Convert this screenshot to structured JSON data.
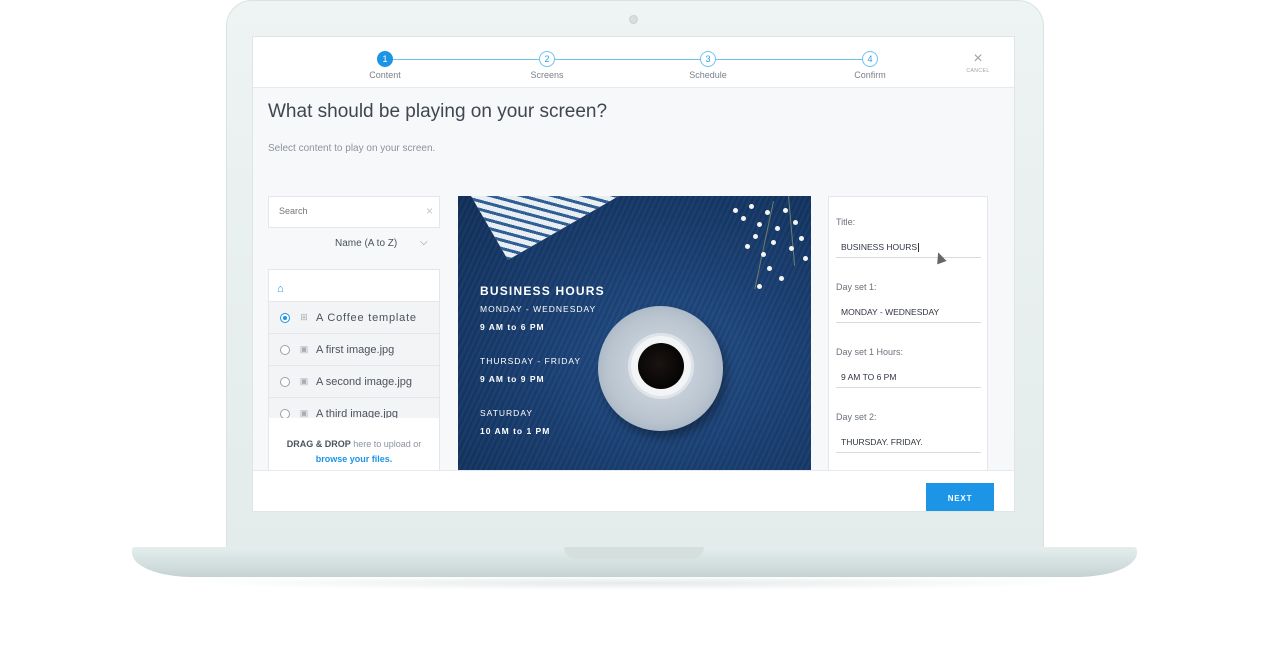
{
  "stepper": {
    "steps": [
      {
        "number": "1",
        "label": "Content",
        "state": "active"
      },
      {
        "number": "2",
        "label": "Screens",
        "state": "pending"
      },
      {
        "number": "3",
        "label": "Schedule",
        "state": "pending"
      },
      {
        "number": "4",
        "label": "Confirm",
        "state": "pending"
      }
    ],
    "cancel_label": "CANCEL",
    "cancel_icon": "close-icon"
  },
  "page": {
    "title": "What should be playing on your screen?",
    "subtitle": "Select content to play on your screen."
  },
  "library": {
    "search_placeholder": "Search",
    "sort_label": "Name (A to Z)",
    "items": [
      {
        "name": "A Coffee template",
        "icon": "template-icon",
        "selected": true
      },
      {
        "name": "A first image.jpg",
        "icon": "image-icon",
        "selected": false
      },
      {
        "name": "A second image.jpg",
        "icon": "image-icon",
        "selected": false
      },
      {
        "name": "A third image.jpg",
        "icon": "image-icon",
        "selected": false
      }
    ],
    "upload_bold": "DRAG & DROP",
    "upload_text": " here to upload or",
    "upload_link": "browse your files."
  },
  "preview": {
    "title": "BUSINESS HOURS",
    "day_set_1": "MONDAY - WEDNESDAY",
    "hours_1": "9 AM to 6 PM",
    "day_set_2": "THURSDAY - FRIDAY",
    "hours_2": "9 AM to 9 PM",
    "day_set_3": "SATURDAY",
    "hours_3": "10 AM to 1 PM",
    "accent_color": "#1a3f72"
  },
  "form": {
    "title_label": "Title:",
    "title_value": "BUSINESS HOURS",
    "day_set_1_label": "Day set 1:",
    "day_set_1_value": "MONDAY - WEDNESDAY",
    "day_set_1_hours_label": "Day set 1 Hours:",
    "day_set_1_hours_value": "9 AM TO 6 PM",
    "day_set_2_label": "Day set 2:",
    "day_set_2_value": "THURSDAY. FRIDAY."
  },
  "footer": {
    "next_label": "NEXT",
    "primary_color": "#1d95e6"
  }
}
